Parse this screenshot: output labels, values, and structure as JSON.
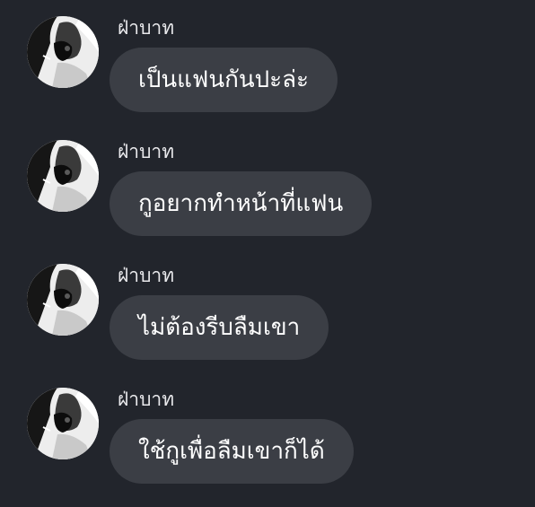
{
  "colors": {
    "background": "#22252c",
    "bubble": "#3b3e45",
    "text": "#ffffff",
    "sender": "#e9e9ec"
  },
  "messages": [
    {
      "sender": "ฝ่าบาท",
      "text": "เป็นแฟนกันปะล่ะ",
      "avatar_icon": "user-avatar-icon"
    },
    {
      "sender": "ฝ่าบาท",
      "text": "กูอยากทำหน้าที่แฟน",
      "avatar_icon": "user-avatar-icon"
    },
    {
      "sender": "ฝ่าบาท",
      "text": "ไม่ต้องรีบลืมเขา",
      "avatar_icon": "user-avatar-icon"
    },
    {
      "sender": "ฝ่าบาท",
      "text": "ใช้กูเพื่อลืมเขาก็ได้",
      "avatar_icon": "user-avatar-icon"
    }
  ]
}
